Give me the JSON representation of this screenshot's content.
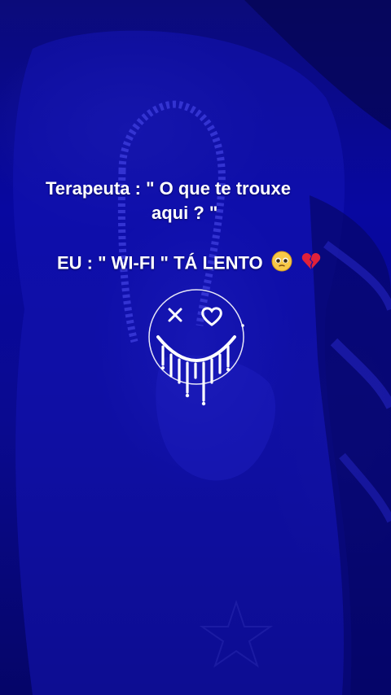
{
  "caption": {
    "line1": "Terapeuta : \" O que te trouxe",
    "line2": "aqui ? \"",
    "line3": "EU : \" WI-FI \"  TÁ LENTO"
  },
  "icons": {
    "emoji_1": "pleading-face-emoji",
    "emoji_2": "broken-heart-emoji",
    "graphic": "dripping-smiley-face"
  },
  "colors": {
    "background": "#0808a0",
    "text": "#ffffff"
  }
}
